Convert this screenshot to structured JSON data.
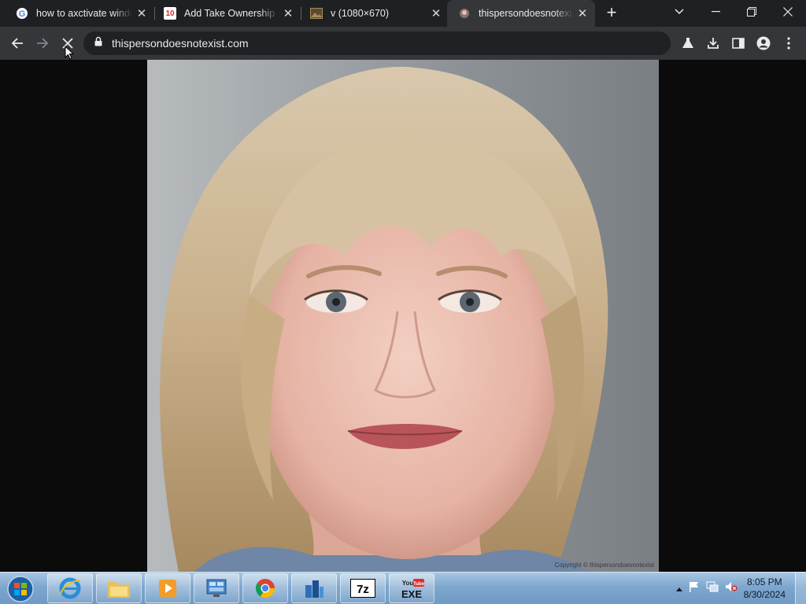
{
  "browser": {
    "tabs": [
      {
        "label": "how to axctivate windows",
        "favicon": "google-icon",
        "active": false
      },
      {
        "label": "Add Take Ownership to",
        "favicon": "windows10-icon",
        "active": false
      },
      {
        "label": "v (1080×670)",
        "favicon": "image-icon",
        "active": false
      },
      {
        "label": "thispersondoesnotexist",
        "favicon": "site-icon",
        "active": true
      }
    ],
    "new_tab_label": "+",
    "address": "thispersondoesnotexist.com"
  },
  "toolbar_icons": [
    "back-icon",
    "forward-icon",
    "stop-icon",
    "lock-icon",
    "share-icon",
    "star-icon",
    "labs-icon",
    "download-icon",
    "side-panel-icon",
    "profile-icon",
    "menu-icon"
  ],
  "page": {
    "image_description": "generated portrait photo",
    "watermark": "Copyright © thispersondoesnotexist"
  },
  "taskbar": {
    "pinned": [
      "internet-explorer-icon",
      "file-explorer-icon",
      "media-player-icon",
      "control-panel-icon",
      "chrome-icon",
      "network-app-icon",
      "7zip-icon",
      "youtube-exe-icon"
    ],
    "seven_zip_label": "7z",
    "youtube_label": "You",
    "youtube_sub": "Tube",
    "exe_label": "EXE",
    "time": "8:05 PM",
    "date": "8/30/2024"
  },
  "colors": {
    "tab_active": "#35363a",
    "tabstrip": "#1f2023",
    "omnibox": "#202124",
    "taskbar": "#7ea7cf"
  }
}
